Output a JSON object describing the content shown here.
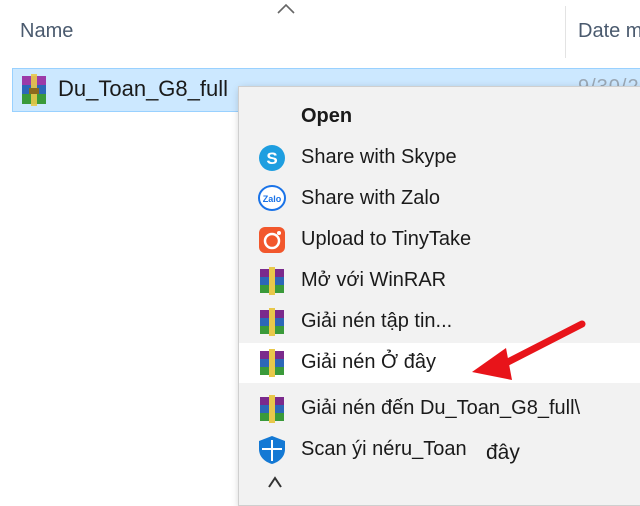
{
  "header": {
    "name_col": "Name",
    "date_col": "Date m"
  },
  "file": {
    "name": "Du_Toan_G8_full",
    "date_partial": "9/30/2"
  },
  "menu": {
    "items": [
      {
        "label": "Open",
        "icon": "none",
        "bold": true
      },
      {
        "label": "Share with Skype",
        "icon": "skype-icon"
      },
      {
        "label": "Share with Zalo",
        "icon": "zalo-icon",
        "icon_text": "Zalo"
      },
      {
        "label": "Upload to TinyTake",
        "icon": "tinytake-icon"
      },
      {
        "label": "Mở với WinRAR",
        "icon": "winrar-icon"
      },
      {
        "label": "Giải nén tập tin...",
        "icon": "winrar-icon"
      },
      {
        "label": "Giải nén Ở đây",
        "icon": "winrar-icon",
        "highlighted": true
      },
      {
        "label": "Giải nén đến Du_Toan_G8_full\\",
        "icon": "winrar-icon"
      },
      {
        "label": "Scan ýi néru_Toan",
        "icon": "defender-icon"
      }
    ],
    "overlay_text": "đây"
  },
  "colors": {
    "selection": "#cce8ff",
    "menu_bg": "#f2f2f2",
    "arrow": "#e8141a",
    "skype": "#1e9ee0",
    "tinytake": "#f2572c",
    "defender": "#1479d4"
  }
}
